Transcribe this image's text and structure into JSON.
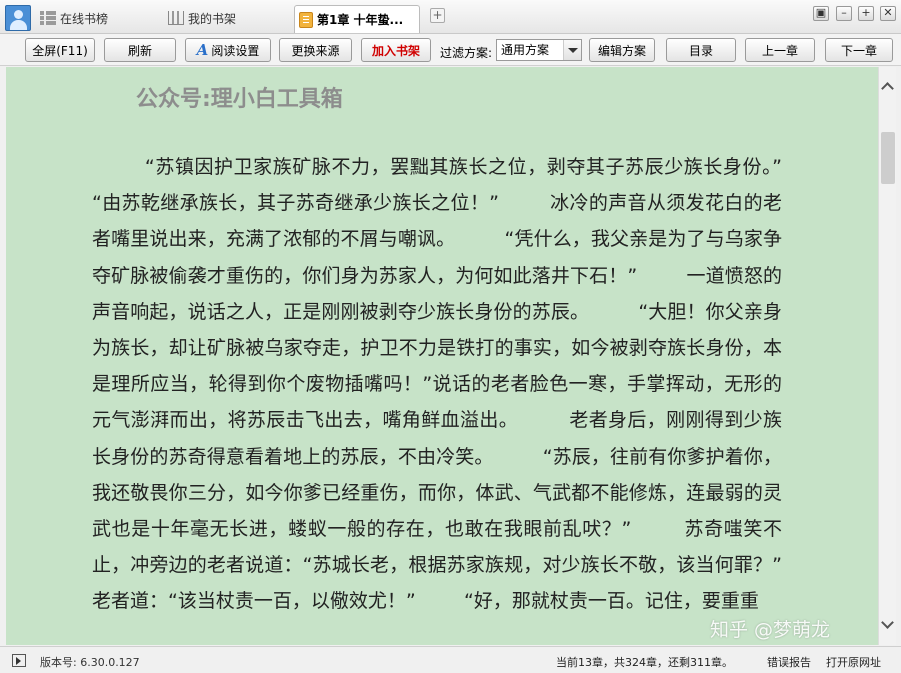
{
  "tabs": [
    {
      "label": "在线书榜",
      "icon": "list-grid-icon"
    },
    {
      "label": "我的书架",
      "icon": "bookshelf-icon"
    },
    {
      "label": "第1章 十年蛰...",
      "icon": "book-icon",
      "active": true
    }
  ],
  "window_buttons": [
    "restore",
    "minimize",
    "maximize",
    "close"
  ],
  "toolbar": {
    "fullscreen": "全屏(F11)",
    "refresh": "刷新",
    "read_settings": "阅读设置",
    "change_source": "更换来源",
    "add_shelf": "加入书架",
    "filter_label": "过滤方案:",
    "filter_value": "通用方案",
    "edit_scheme": "编辑方案",
    "toc": "目录",
    "prev_chapter": "上一章",
    "next_chapter": "下一章"
  },
  "reader": {
    "header_watermark": "公众号:理小白工具箱",
    "text": "        “苏镇因护卫家族矿脉不力，罢黜其族长之位，剥夺其子苏辰少族长身份。”        “由苏乾继承族长，其子苏奇继承少族长之位！”        冰冷的声音从须发花白的老者嘴里说出来，充满了浓郁的不屑与嘲讽。        “凭什么，我父亲是为了与乌家争夺矿脉被偷袭才重伤的，你们身为苏家人，为何如此落井下石！”        一道愤怒的声音响起，说话之人，正是刚刚被剥夺少族长身份的苏辰。        “大胆！你父亲身为族长，却让矿脉被乌家夺走，护卫不力是铁打的事实，如今被剥夺族长身份，本是理所应当，轮得到你个废物插嘴吗！”说话的老者脸色一寒，手掌挥动，无形的元气澎湃而出，将苏辰击飞出去，嘴角鲜血溢出。        老者身后，刚刚得到少族长身份的苏奇得意看着地上的苏辰，不由冷笑。        “苏辰，往前有你爹护着你，我还敬畏你三分，如今你爹已经重伤，而你，体武、气武都不能修炼，连最弱的灵武也是十年毫无长进，蝼蚁一般的存在，也敢在我眼前乱吠？”        苏奇嗤笑不止，冲旁边的老者说道：“苏城长老，根据苏家族规，对少族长不敬，该当何罪？”        老者道：“该当杖责一百，以儆效尤！”        “好，那就杖责一百。记住，要重重"
  },
  "statusbar": {
    "version": "版本号: 6.30.0.127",
    "progress": "当前13章，共324章，还剩311章。",
    "error_report": "错误报告",
    "open_url": "打开原网址"
  },
  "overlay_watermark": "知乎 @梦萌龙",
  "colors": {
    "reader_bg": "#c7e3c8",
    "add_shelf": "#d00000",
    "text": "#222222"
  }
}
